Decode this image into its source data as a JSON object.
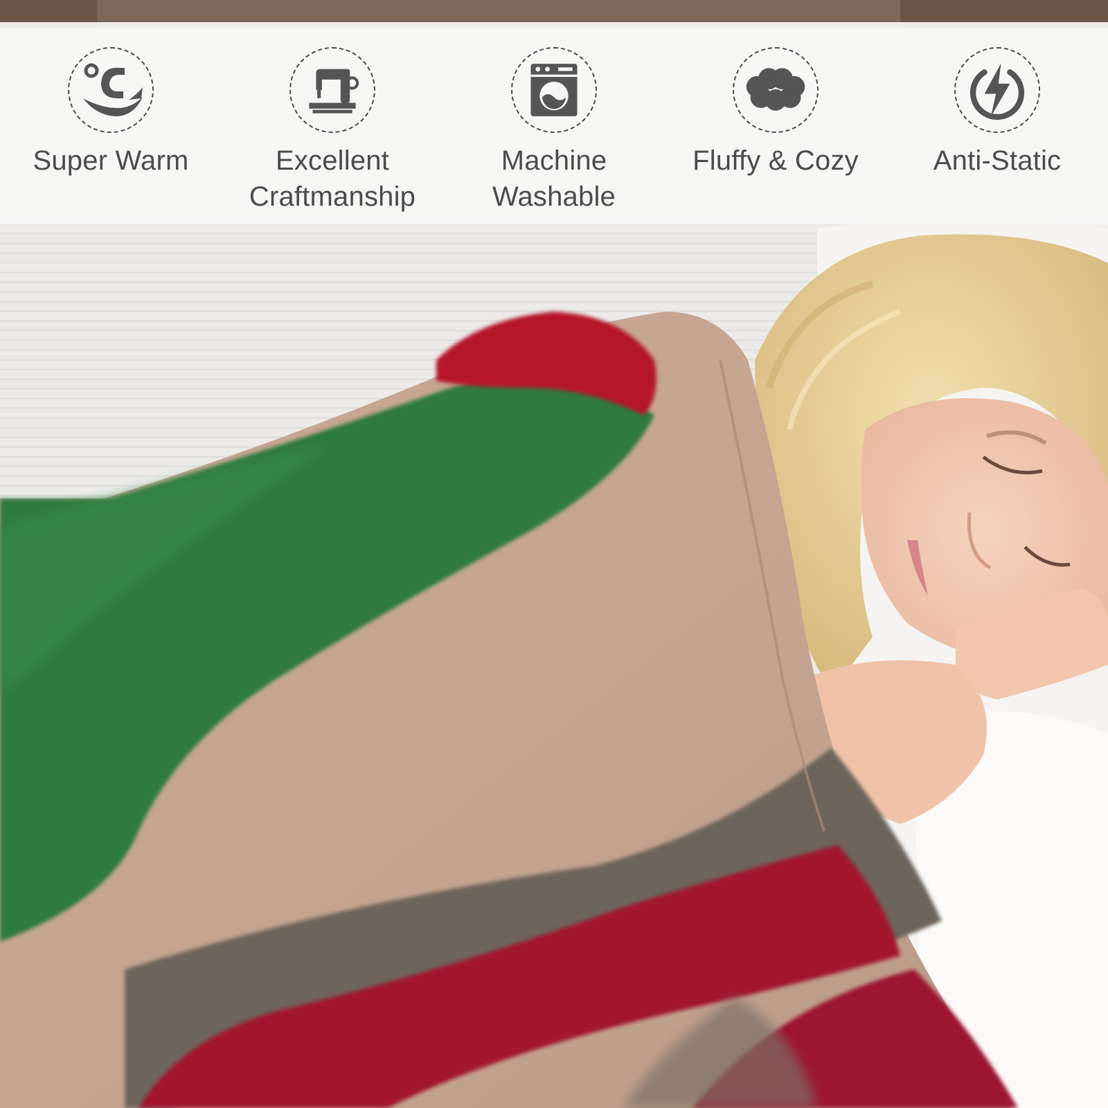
{
  "features": [
    {
      "label": "Super Warm",
      "icon": "warm-icon"
    },
    {
      "label": "Excellent\nCraftmanship",
      "icon": "sewing-machine-icon"
    },
    {
      "label": "Machine\nWashable",
      "icon": "washing-machine-icon"
    },
    {
      "label": "Fluffy & Cozy",
      "icon": "cloud-icon"
    },
    {
      "label": "Anti-Static",
      "icon": "lightning-icon"
    }
  ],
  "colors": {
    "banner": "#f6f6f6",
    "icon": "#555555",
    "text": "#4b4b4b",
    "blanket_beige": "#c8a896",
    "blanket_green": "#2f7a3f",
    "blanket_red": "#b0122a",
    "hair": "#e7cf97",
    "skin": "#f0c8b0",
    "pillow": "#f3f1ef"
  }
}
